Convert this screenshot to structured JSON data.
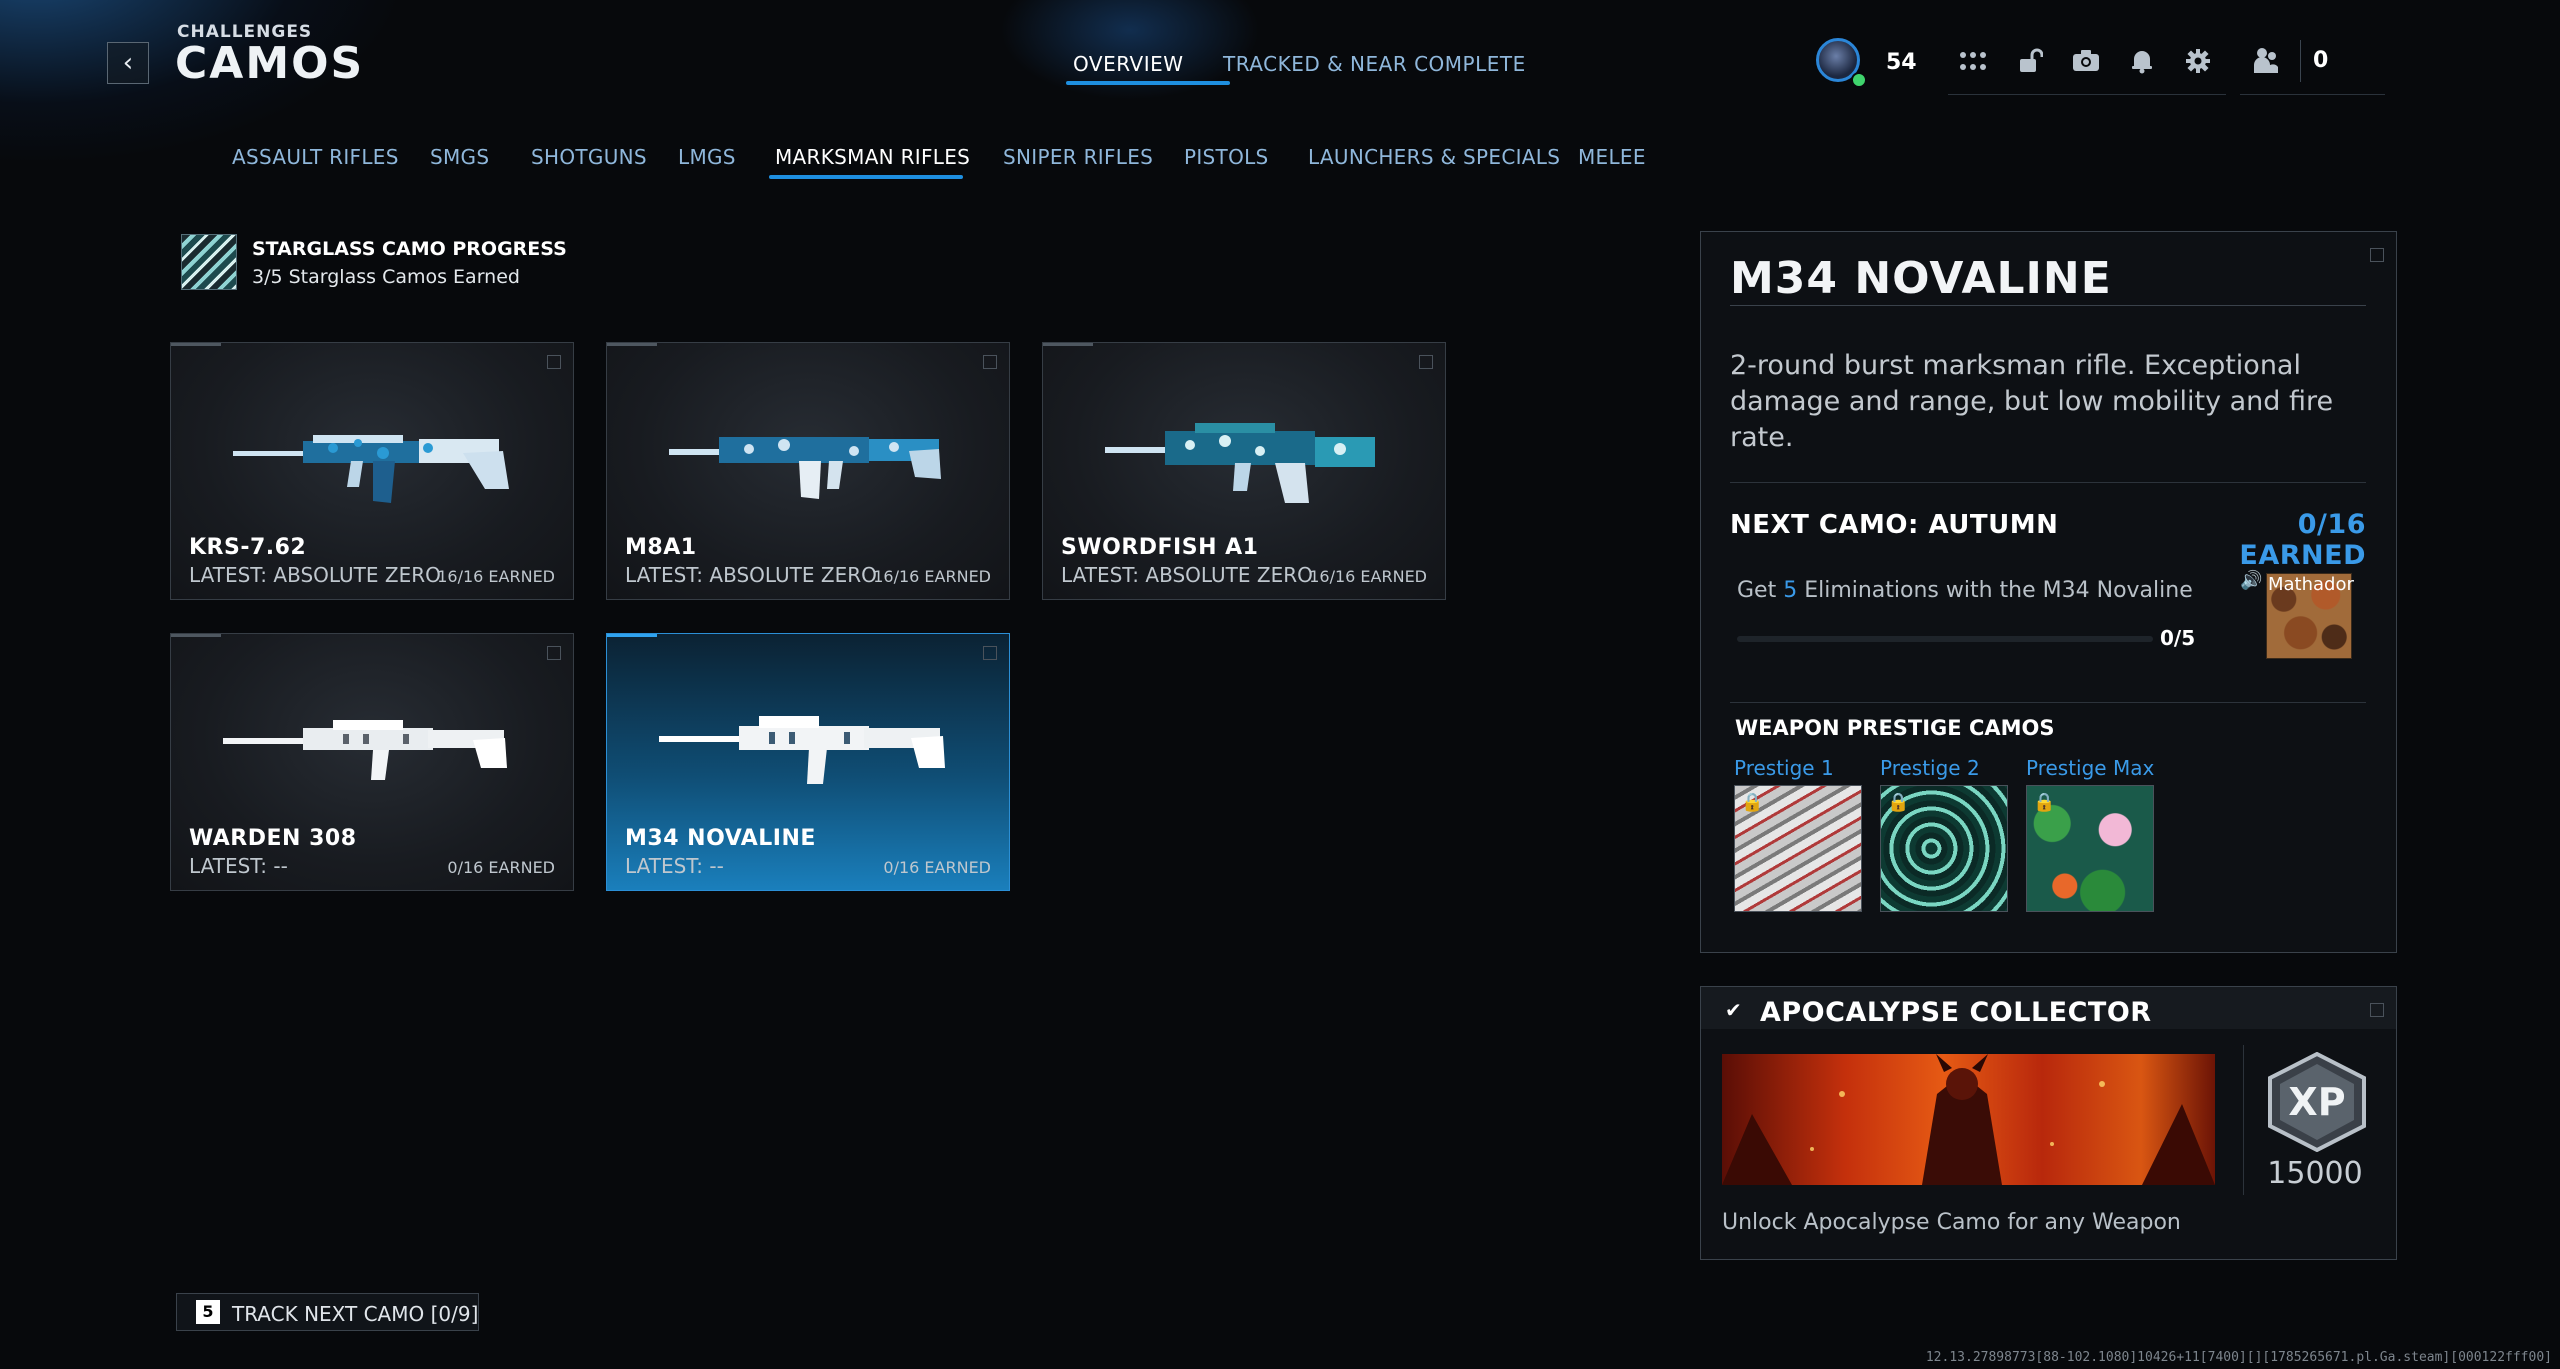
{
  "header": {
    "subtitle": "CHALLENGES",
    "title": "CAMOS",
    "tabs": [
      {
        "label": "OVERVIEW",
        "active": true
      },
      {
        "label": "TRACKED & NEAR COMPLETE",
        "active": false
      }
    ],
    "level": "54",
    "count": "0",
    "icons": [
      "apps-grid-icon",
      "unlock-icon",
      "camera-icon",
      "bell-icon",
      "gear-icon",
      "party-icon"
    ]
  },
  "categories": [
    {
      "label": "ASSAULT RIFLES"
    },
    {
      "label": "SMGS"
    },
    {
      "label": "SHOTGUNS"
    },
    {
      "label": "LMGS"
    },
    {
      "label": "MARKSMAN RIFLES",
      "active": true
    },
    {
      "label": "SNIPER RIFLES"
    },
    {
      "label": "PISTOLS"
    },
    {
      "label": "LAUNCHERS & SPECIALS"
    },
    {
      "label": "MELEE"
    }
  ],
  "starglass": {
    "title": "STARGLASS CAMO PROGRESS",
    "subtitle": "3/5 Starglass Camos Earned"
  },
  "weapons": [
    {
      "name": "KRS-7.62",
      "latest": "LATEST: ABSOLUTE ZERO",
      "earned": "16/16 EARNED"
    },
    {
      "name": "M8A1",
      "latest": "LATEST: ABSOLUTE ZERO",
      "earned": "16/16 EARNED"
    },
    {
      "name": "SWORDFISH A1",
      "latest": "LATEST: ABSOLUTE ZERO",
      "earned": "16/16 EARNED"
    },
    {
      "name": "WARDEN 308",
      "latest": "LATEST: --",
      "earned": "0/16 EARNED"
    },
    {
      "name": "M34 NOVALINE",
      "latest": "LATEST: --",
      "earned": "0/16 EARNED",
      "selected": true
    }
  ],
  "detail": {
    "title": "M34 NOVALINE",
    "description": "2-round burst marksman rifle. Exceptional damage and range, but low mobility and fire rate.",
    "next_camo": "NEXT CAMO: AUTUMN",
    "next_earned": "0/16 EARNED",
    "challenge_prefix": "Get ",
    "challenge_count": "5",
    "challenge_suffix": " Eliminations with the M34 Novaline",
    "progress_text": "0/5",
    "progress_fraction": 0,
    "camo_owner": "Mathador",
    "prestige_title": "WEAPON PRESTIGE CAMOS",
    "prestige": [
      {
        "label": "Prestige 1"
      },
      {
        "label": "Prestige 2"
      },
      {
        "label": "Prestige Max"
      }
    ]
  },
  "collector": {
    "title": "APOCALYPSE COLLECTOR",
    "xp_label": "XP",
    "xp_value": "15000",
    "description": "Unlock Apocalypse Camo for any Weapon"
  },
  "track": {
    "key": "5",
    "label": "TRACK NEXT CAMO [0/9]"
  },
  "footer_code": "12.13.27898773[88-102.1080]10426+11[7400][][1785265671.pl.Ga.steam][000122fff00]",
  "colors": {
    "accent": "#1e8fe0",
    "accent_text": "#3a9ae8",
    "background": "#07090c"
  }
}
